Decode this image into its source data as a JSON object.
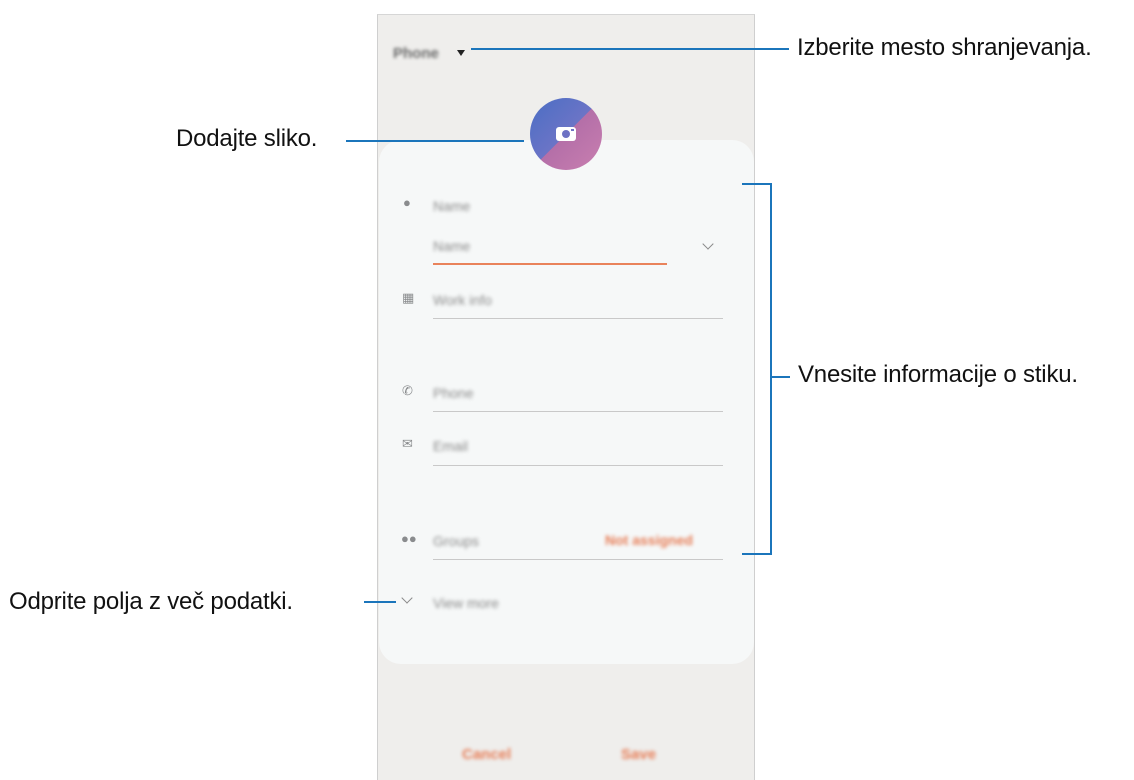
{
  "header": {
    "storage_label": "Phone"
  },
  "form": {
    "name_label": "Name",
    "name_field_value": "Name",
    "work_info_label": "Work info",
    "phone_label": "Phone",
    "email_label": "Email",
    "groups_label": "Groups",
    "groups_action": "Not assigned",
    "view_more_label": "View more"
  },
  "footer": {
    "cancel_label": "Cancel",
    "save_label": "Save"
  },
  "callouts": {
    "storage": "Izberite mesto shranjevanja.",
    "picture": "Dodajte sliko.",
    "contact_info": "Vnesite informacije o stiku.",
    "more_fields": "Odprite polja z več podatki."
  },
  "colors": {
    "accent": "#e67c55",
    "callout_line": "#1b75bb"
  },
  "icons": [
    "caret-down-icon",
    "camera-icon",
    "person-icon",
    "building-icon",
    "phone-icon",
    "email-icon",
    "groups-icon",
    "chevron-down-icon"
  ]
}
